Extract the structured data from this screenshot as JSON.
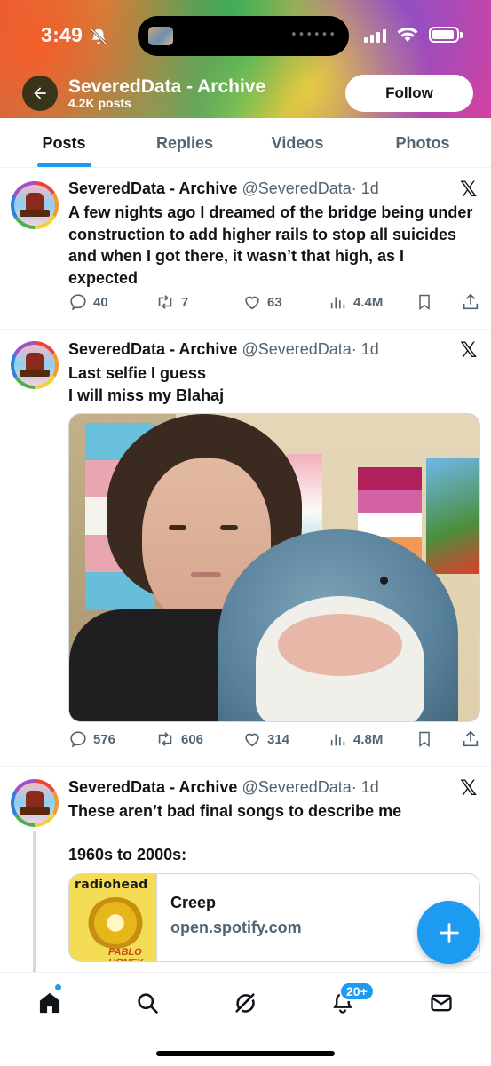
{
  "status_bar": {
    "time": "3:49"
  },
  "header": {
    "profile_name": "SeveredData - Archive",
    "post_count": "4.2K posts",
    "follow_label": "Follow"
  },
  "tabs": [
    {
      "label": "Posts",
      "active": true
    },
    {
      "label": "Replies",
      "active": false
    },
    {
      "label": "Videos",
      "active": false
    },
    {
      "label": "Photos",
      "active": false
    }
  ],
  "posts": [
    {
      "name": "SeveredData - Archive",
      "handle": "@SeveredData",
      "time": "· 1d",
      "text": "A few nights ago I dreamed of the bridge being under construction to add higher rails to stop all suicides and when I got there, it wasn’t that high, as I expected",
      "replies": "40",
      "reposts": "7",
      "likes": "63",
      "views": "4.4M"
    },
    {
      "name": "SeveredData - Archive",
      "handle": "@SeveredData",
      "time": "· 1d",
      "text_line1": "Last selfie I guess",
      "text_line2": "I will miss my Blahaj",
      "replies": "576",
      "reposts": "606",
      "likes": "314",
      "views": "4.8M"
    },
    {
      "name": "SeveredData - Archive",
      "handle": "@SeveredData",
      "time": "· 1d",
      "text_line1": "These aren’t bad final songs to describe me",
      "text_line2": "1960s to 2000s:",
      "card": {
        "album_title": "radiohead",
        "album_subtitle": "PABLO HONEY",
        "title": "Creep",
        "domain": "open.spotify.com"
      }
    }
  ],
  "bottom_nav": {
    "notification_badge": "20+"
  },
  "colors": {
    "accent": "#1d9bf0",
    "text": "#0f1419",
    "muted": "#536471"
  },
  "icons": [
    "back-arrow-icon",
    "bell-off-icon",
    "x-logo-icon",
    "reply-icon",
    "repost-icon",
    "like-icon",
    "views-icon",
    "bookmark-icon",
    "share-icon",
    "plus-icon",
    "home-icon",
    "search-icon",
    "grok-icon",
    "bell-icon",
    "mail-icon"
  ]
}
